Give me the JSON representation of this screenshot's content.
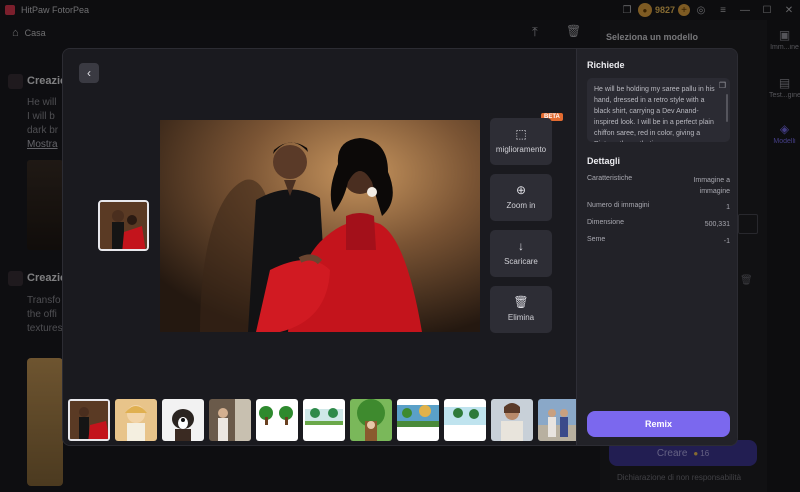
{
  "app": {
    "title": "HitPaw FotorPea",
    "credits": "9827"
  },
  "nav": {
    "home_label": "Casa"
  },
  "feed": {
    "card1": {
      "title": "Creazio",
      "line1": "He will",
      "line2": "I will b",
      "line3": "dark br",
      "link": "Mostra"
    },
    "card2": {
      "title": "Creazio",
      "line1": "Transfo",
      "line2": "the offi",
      "line3": "textures"
    }
  },
  "bg_panel": {
    "title": "Seleziona un modello",
    "side_items": [
      {
        "icon": "image-icon",
        "label": "Imm...ine"
      },
      {
        "icon": "text-image-icon",
        "label": "Test...gine"
      },
      {
        "icon": "model-icon",
        "label": "Modelli"
      }
    ],
    "create_label": "Creare",
    "create_cost": "16",
    "disclaimer": "Dichiarazione di non responsabilità"
  },
  "modal": {
    "actions": [
      {
        "label": "miglioramento",
        "icon": "enhance-icon"
      },
      {
        "label": "Zoom in",
        "icon": "zoom-in-icon"
      },
      {
        "label": "Scaricare",
        "icon": "download-icon"
      },
      {
        "label": "Elimina",
        "icon": "trash-icon"
      }
    ],
    "beta_badge": "BETA",
    "details_panel": {
      "prompt_heading": "Richiede",
      "prompt_text": "He will be holding my saree pallu in his hand, dressed in a retro style with a black shirt, carrying a Dev Anand-inspired look. I will be in a perfect plain chiffon saree, red in color, giving a Pinterestly aesthetic",
      "details_heading": "Dettagli",
      "rows": [
        {
          "key": "Caratteristiche",
          "value": "Immagine a immagine"
        },
        {
          "key": "Numero di immagini",
          "value": "1"
        },
        {
          "key": "Dimensione",
          "value": "500,331"
        },
        {
          "key": "Seme",
          "value": "-1"
        }
      ],
      "remix_label": "Remix"
    },
    "thumbnails": [
      {
        "subject": "couple-red-saree",
        "selected": true
      },
      {
        "subject": "cartoon-girl"
      },
      {
        "subject": "puppy"
      },
      {
        "subject": "woman-portrait"
      },
      {
        "subject": "cartoon-trees"
      },
      {
        "subject": "cartoon-trees-2"
      },
      {
        "subject": "cartoon-tree-character"
      },
      {
        "subject": "cartoon-landscape"
      },
      {
        "subject": "cartoon-trees-3"
      },
      {
        "subject": "bearded-man"
      },
      {
        "subject": "couple-outdoor"
      }
    ]
  },
  "colors": {
    "accent": "#7b68ee",
    "credits": "#e5a640",
    "beta": "#e36b30"
  }
}
